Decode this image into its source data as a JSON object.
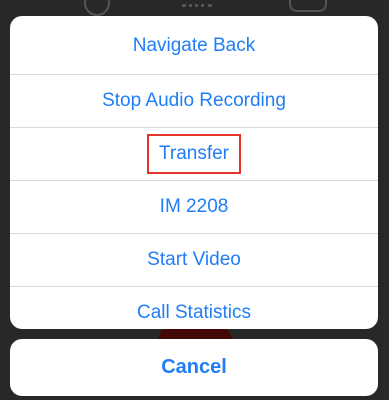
{
  "action_sheet": {
    "items": [
      {
        "label": "Navigate Back"
      },
      {
        "label": "Stop Audio Recording"
      },
      {
        "label": "Transfer"
      },
      {
        "label": "IM 2208"
      },
      {
        "label": "Start Video"
      },
      {
        "label": "Call Statistics"
      }
    ],
    "cancel_label": "Cancel"
  },
  "colors": {
    "accent": "#1f7ef7",
    "highlight_border": "#e2332d",
    "end_call": "#7a1010"
  },
  "icons": {
    "background_left": "mute-icon",
    "background_center": "keypad-icon",
    "background_right": "speaker-icon",
    "background_bottom": "end-call-button"
  }
}
